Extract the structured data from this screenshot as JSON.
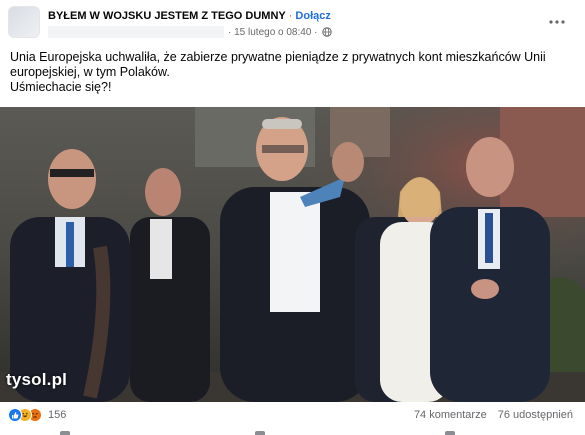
{
  "post": {
    "group_name": "BYŁEM W WOJSKU JESTEM Z TEGO DUMNY",
    "separator": "·",
    "join_label": "Dołącz",
    "date": "· 15 lutego o 08:40 ·",
    "more_icon": "more-horizontal-icon",
    "text_line1": "Unia Europejska uchwaliła, że zabierze prywatne pieniądze z prywatnych kont mieszkańców Unii",
    "text_line2": "europejskiej,  w tym Polaków.",
    "text_line3": "Uśmiechacie się?!",
    "watermark": "tysol.pl"
  },
  "reactions": {
    "icons": [
      "like-reaction-icon",
      "haha-reaction-icon",
      "angry-reaction-icon"
    ],
    "count": "156",
    "comments": "74 komentarze",
    "shares": "76 udostępnień"
  },
  "colors": {
    "join": "#216fdb",
    "muted": "#65676b",
    "like": "#1877f2"
  }
}
